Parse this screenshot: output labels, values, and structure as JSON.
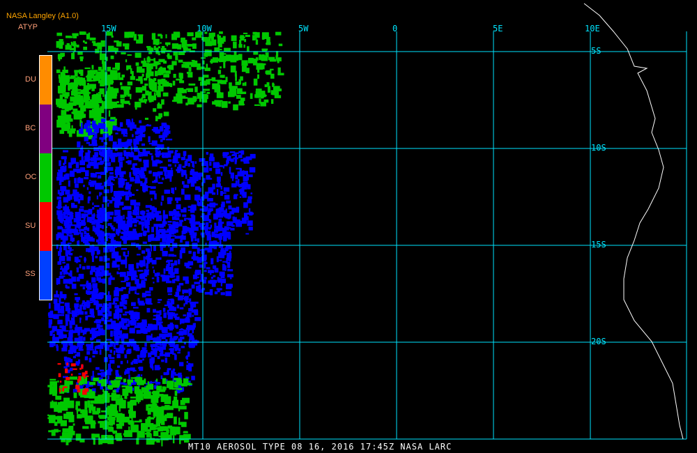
{
  "header": {
    "source": "NASA Langley (A1.0)",
    "product": "ATYP"
  },
  "longitude_labels": [
    "15W",
    "10W",
    "5W",
    "0",
    "5E",
    "10E"
  ],
  "latitude_labels": [
    "5S",
    "10S",
    "15S",
    "20S"
  ],
  "legend": [
    {
      "label": "DU",
      "color": "#ff8c00"
    },
    {
      "label": "BC",
      "color": "#800080"
    },
    {
      "label": "OC",
      "color": "#00c800"
    },
    {
      "label": "SU",
      "color": "#ff0000"
    },
    {
      "label": "SS",
      "color": "#0028ff"
    }
  ],
  "footer": "MT10  AEROSOL TYPE  08 16, 2016 17:45Z  NASA LARC",
  "colors": {
    "grid": "#00e5ff",
    "coast": "#ffffff"
  }
}
